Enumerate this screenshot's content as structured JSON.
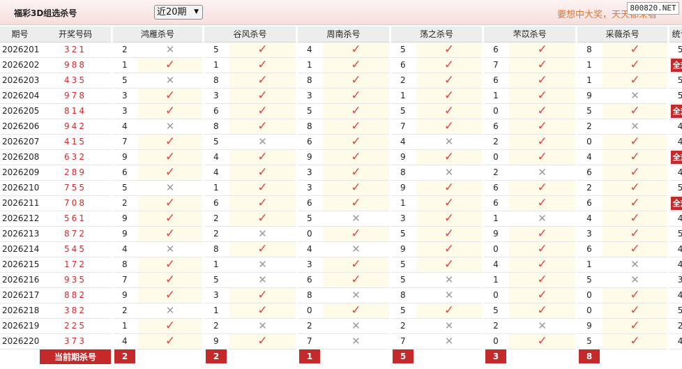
{
  "header": {
    "title": "福彩3D组选杀号",
    "period_selected": "近20期",
    "slogan": "要想中大奖，天天都来看",
    "watermark": "800820.NET"
  },
  "table": {
    "col_issue": "期号",
    "col_draw": "开奖号码",
    "col_stat": "统计",
    "experts": [
      "鸿雁杀号",
      "谷风杀号",
      "周南杀号",
      "荡之杀号",
      "芣苡杀号",
      "采薇杀号"
    ],
    "all_right_label": "全对",
    "rows": [
      {
        "issue": "2026201",
        "draw": "321",
        "picks": [
          [
            2,
            0
          ],
          [
            5,
            1
          ],
          [
            4,
            1
          ],
          [
            5,
            1
          ],
          [
            6,
            1
          ],
          [
            8,
            1
          ]
        ],
        "stat": "5"
      },
      {
        "issue": "2026202",
        "draw": "988",
        "picks": [
          [
            1,
            1
          ],
          [
            1,
            1
          ],
          [
            1,
            1
          ],
          [
            6,
            1
          ],
          [
            7,
            1
          ],
          [
            1,
            1
          ]
        ],
        "stat": "全对"
      },
      {
        "issue": "2026203",
        "draw": "435",
        "picks": [
          [
            5,
            0
          ],
          [
            8,
            1
          ],
          [
            8,
            1
          ],
          [
            2,
            1
          ],
          [
            6,
            1
          ],
          [
            1,
            1
          ]
        ],
        "stat": "5"
      },
      {
        "issue": "2026204",
        "draw": "978",
        "picks": [
          [
            3,
            1
          ],
          [
            3,
            1
          ],
          [
            3,
            1
          ],
          [
            1,
            1
          ],
          [
            1,
            1
          ],
          [
            9,
            0
          ]
        ],
        "stat": "5"
      },
      {
        "issue": "2026205",
        "draw": "814",
        "picks": [
          [
            3,
            1
          ],
          [
            6,
            1
          ],
          [
            5,
            1
          ],
          [
            5,
            1
          ],
          [
            0,
            1
          ],
          [
            5,
            1
          ]
        ],
        "stat": "全对"
      },
      {
        "issue": "2026206",
        "draw": "942",
        "picks": [
          [
            4,
            0
          ],
          [
            8,
            1
          ],
          [
            8,
            1
          ],
          [
            7,
            1
          ],
          [
            6,
            1
          ],
          [
            2,
            0
          ]
        ],
        "stat": "4"
      },
      {
        "issue": "2026207",
        "draw": "415",
        "picks": [
          [
            7,
            1
          ],
          [
            5,
            0
          ],
          [
            6,
            1
          ],
          [
            4,
            0
          ],
          [
            2,
            1
          ],
          [
            0,
            1
          ]
        ],
        "stat": "4"
      },
      {
        "issue": "2026208",
        "draw": "632",
        "picks": [
          [
            9,
            1
          ],
          [
            4,
            1
          ],
          [
            9,
            1
          ],
          [
            9,
            1
          ],
          [
            0,
            1
          ],
          [
            4,
            1
          ]
        ],
        "stat": "全对"
      },
      {
        "issue": "2026209",
        "draw": "289",
        "picks": [
          [
            6,
            1
          ],
          [
            4,
            1
          ],
          [
            3,
            1
          ],
          [
            8,
            0
          ],
          [
            2,
            0
          ],
          [
            6,
            1
          ]
        ],
        "stat": "4"
      },
      {
        "issue": "2026210",
        "draw": "755",
        "picks": [
          [
            5,
            0
          ],
          [
            1,
            1
          ],
          [
            3,
            1
          ],
          [
            9,
            1
          ],
          [
            6,
            1
          ],
          [
            2,
            1
          ]
        ],
        "stat": "5"
      },
      {
        "issue": "2026211",
        "draw": "708",
        "picks": [
          [
            2,
            1
          ],
          [
            6,
            1
          ],
          [
            6,
            1
          ],
          [
            1,
            1
          ],
          [
            6,
            1
          ],
          [
            6,
            1
          ]
        ],
        "stat": "全对"
      },
      {
        "issue": "2026212",
        "draw": "561",
        "picks": [
          [
            9,
            1
          ],
          [
            2,
            1
          ],
          [
            5,
            0
          ],
          [
            3,
            1
          ],
          [
            1,
            0
          ],
          [
            4,
            1
          ]
        ],
        "stat": "4"
      },
      {
        "issue": "2026213",
        "draw": "872",
        "picks": [
          [
            9,
            1
          ],
          [
            2,
            0
          ],
          [
            0,
            1
          ],
          [
            5,
            1
          ],
          [
            9,
            1
          ],
          [
            3,
            1
          ]
        ],
        "stat": "5"
      },
      {
        "issue": "2026214",
        "draw": "545",
        "picks": [
          [
            4,
            0
          ],
          [
            8,
            1
          ],
          [
            4,
            0
          ],
          [
            9,
            1
          ],
          [
            0,
            1
          ],
          [
            6,
            1
          ]
        ],
        "stat": "4"
      },
      {
        "issue": "2026215",
        "draw": "172",
        "picks": [
          [
            8,
            1
          ],
          [
            1,
            0
          ],
          [
            3,
            1
          ],
          [
            5,
            1
          ],
          [
            4,
            1
          ],
          [
            1,
            0
          ]
        ],
        "stat": "4"
      },
      {
        "issue": "2026216",
        "draw": "935",
        "picks": [
          [
            7,
            1
          ],
          [
            5,
            0
          ],
          [
            6,
            1
          ],
          [
            5,
            0
          ],
          [
            1,
            1
          ],
          [
            5,
            0
          ]
        ],
        "stat": "3"
      },
      {
        "issue": "2026217",
        "draw": "882",
        "picks": [
          [
            9,
            1
          ],
          [
            3,
            1
          ],
          [
            8,
            0
          ],
          [
            8,
            0
          ],
          [
            0,
            1
          ],
          [
            0,
            1
          ]
        ],
        "stat": "4"
      },
      {
        "issue": "2026218",
        "draw": "382",
        "picks": [
          [
            2,
            0
          ],
          [
            1,
            1
          ],
          [
            0,
            1
          ],
          [
            5,
            1
          ],
          [
            5,
            1
          ],
          [
            0,
            1
          ]
        ],
        "stat": "5"
      },
      {
        "issue": "2026219",
        "draw": "225",
        "picks": [
          [
            1,
            1
          ],
          [
            2,
            0
          ],
          [
            2,
            0
          ],
          [
            2,
            0
          ],
          [
            2,
            0
          ],
          [
            9,
            1
          ]
        ],
        "stat": "2"
      },
      {
        "issue": "2026220",
        "draw": "373",
        "picks": [
          [
            4,
            1
          ],
          [
            9,
            1
          ],
          [
            7,
            0
          ],
          [
            7,
            0
          ],
          [
            0,
            1
          ],
          [
            5,
            1
          ]
        ],
        "stat": "4"
      }
    ],
    "current": {
      "label": "当前期杀号",
      "picks": [
        "2",
        "2",
        "1",
        "5",
        "3",
        "8"
      ]
    }
  }
}
